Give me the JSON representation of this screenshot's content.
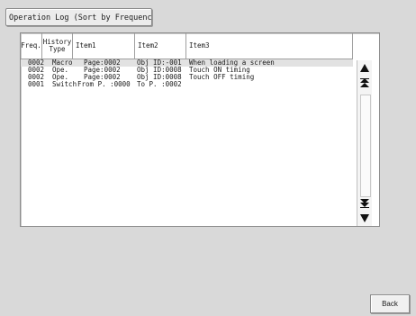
{
  "title_tab": "Operation Log (Sort by Frequency)",
  "columns": {
    "freq": "Freq.",
    "history_type": "History Type",
    "item1": "Item1",
    "item2": "Item2",
    "item3": "Item3"
  },
  "rows": [
    {
      "freq": "0002",
      "type": "Macro",
      "item1": "Page:0002",
      "item2": "Obj ID:-001",
      "item3": "When loading a screen"
    },
    {
      "freq": "0002",
      "type": "Ope.",
      "item1": "Page:0002",
      "item2": "Obj ID:0008",
      "item3": "Touch ON timing"
    },
    {
      "freq": "0002",
      "type": "Ope.",
      "item1": "Page:0002",
      "item2": "Obj ID:0008",
      "item3": "Touch OFF timing"
    },
    {
      "freq": "0001",
      "type": "Switch",
      "item1": "From P. :0000",
      "item2": "To P. :0002",
      "item3": ""
    }
  ],
  "scroll": {
    "up_icon": "triangle-up-icon",
    "page_up_icon": "double-triangle-up-icon",
    "page_down_icon": "double-triangle-down-icon",
    "down_icon": "triangle-down-icon"
  },
  "back_label": "Back"
}
